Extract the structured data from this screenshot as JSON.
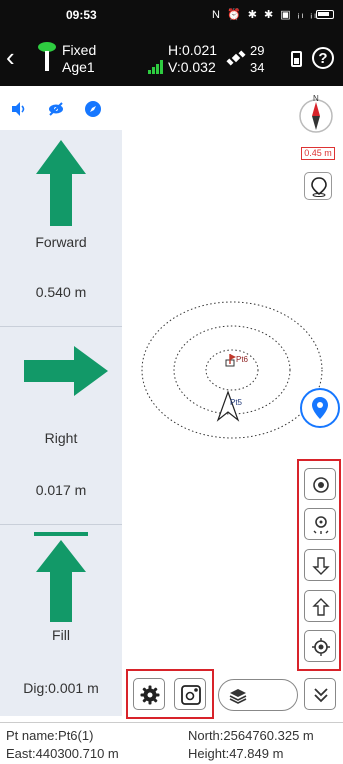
{
  "status_bar": {
    "time": "09:53",
    "icons": "N ⏰ ✱ ✱ ▣ ᵢₗ ᵢₗ"
  },
  "header": {
    "fix_status": "Fixed",
    "age": "Age1",
    "h_precision": "H:0.021",
    "v_precision": "V:0.032",
    "sats_used": "29",
    "sats_total": "34",
    "help_glyph": "?"
  },
  "panel": {
    "forward_label": "Forward",
    "forward_value": "0.540 m",
    "right_label": "Right",
    "right_value": "0.017 m",
    "fill_label": "Fill",
    "dig_value": "Dig:0.001 m"
  },
  "map": {
    "scale": "0.45 m",
    "target_point": "Pt6",
    "current_point": "Pt5",
    "compass_north": "N"
  },
  "footer": {
    "pt_name": "Pt name:Pt6(1)",
    "north": "North:2564760.325 m",
    "east": "East:440300.710 m",
    "height": "Height:47.849 m"
  },
  "colors": {
    "arrow_green": "#129968",
    "accent_blue": "#1677ff",
    "highlight_red": "#d8232a",
    "panel_bg": "#e8ecf3",
    "header_bg": "#0d0d0d"
  },
  "icons": [
    "back-icon",
    "rover-icon",
    "signal-icon",
    "satellite-icon",
    "device-battery-icon",
    "help-icon",
    "speaker-icon",
    "eye-off-icon",
    "compass-small-icon",
    "compass-icon",
    "locate-icon",
    "target-icon",
    "location-pin-icon",
    "gear-icon",
    "map-settings-icon",
    "layers-icon",
    "chevron-double-down-icon",
    "arrow-down-icon",
    "arrow-up-icon",
    "crosshair-icon",
    "radar-icon"
  ]
}
